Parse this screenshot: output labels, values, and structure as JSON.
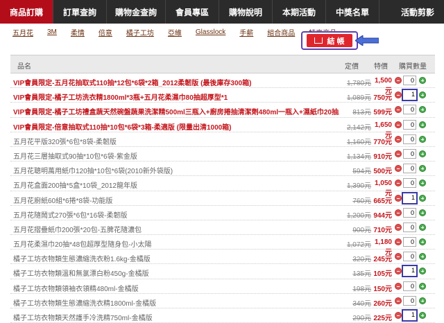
{
  "topnav": {
    "tabs": [
      {
        "label": "商品訂購",
        "active": true
      },
      {
        "label": "訂單查詢"
      },
      {
        "label": "購物金查詢"
      },
      {
        "label": "會員專區"
      },
      {
        "label": "購物說明"
      },
      {
        "label": "本期活動"
      },
      {
        "label": "中獎名單"
      },
      {
        "label": "活動剪影"
      }
    ]
  },
  "subnav": {
    "links": [
      "五月花",
      "3M",
      "柔情",
      "倍意",
      "橘子工坊",
      "亞維",
      "Glasslock",
      "手薪",
      "組合商品",
      "特賣商品"
    ]
  },
  "checkout": {
    "label": "結 帳"
  },
  "table": {
    "headers": {
      "name": "品名",
      "orig": "定價",
      "sale": "特價",
      "qty": "購買數量"
    },
    "rows": [
      {
        "name": "VIP會員限定-五月花抽取式110抽*12包*6袋*2箱_2012柔韌版 (最後庫存300箱)",
        "orig": "1,780元",
        "sale": "1,500元",
        "qty": "0",
        "vip": true
      },
      {
        "name": "VIP會員限定-橘子工坊洗衣精1800ml*3瓶+五月花柔濕巾80抽超厚型*1",
        "orig": "1,089元",
        "sale": "750元",
        "qty": "1",
        "vip": true,
        "highlight": true
      },
      {
        "name": "VIP會員限定-橘子工坊禮盒蔬天然碗盤蔬果洗潔精500ml三瓶入+廚房捲抽清潔劑480ml一瓶入+濕紙巾20抽三包",
        "orig": "813元",
        "sale": "599元",
        "qty": "0",
        "vip": true
      },
      {
        "name": "VIP會員限定-倍意抽取式110抽*10包*6袋*3箱-柔適版 (限量出清1000箱)",
        "orig": "2,142元",
        "sale": "1,650元",
        "qty": "0",
        "vip": true
      },
      {
        "name": "五月花平版320張*6包*8袋-柔韌版",
        "orig": "1,160元",
        "sale": "770元",
        "qty": "0"
      },
      {
        "name": "五月花三層抽取式90抽*10包*6袋-紫金版",
        "orig": "1,134元",
        "sale": "910元",
        "qty": "0"
      },
      {
        "name": "五月花聰明萬用紙巾120抽*10包*6袋(2010新外袋版)",
        "orig": "594元",
        "sale": "500元",
        "qty": "0"
      },
      {
        "name": "五月花盒面200抽*5盒*10袋_2012龍年版",
        "orig": "1,390元",
        "sale": "1,050元",
        "qty": "0"
      },
      {
        "name": "五月花廚紙60組*6捲*8袋-功能版",
        "orig": "760元",
        "sale": "665元",
        "qty": "1",
        "highlight": true
      },
      {
        "name": "五月花隨鬧式270張*6包*16袋-柔韌版",
        "orig": "1,200元",
        "sale": "944元",
        "qty": "0"
      },
      {
        "name": "五月花摺疊紙巾200張*20包-五脾花隨濃包",
        "orig": "900元",
        "sale": "710元",
        "qty": "0"
      },
      {
        "name": "五月花柔濕巾20抽*48包超厚型隨身包-小太陽",
        "orig": "1,072元",
        "sale": "1,180元",
        "qty": "0"
      },
      {
        "name": "橘子工坊衣物類生態濃縮洗衣粉1.6kg-金橘版",
        "orig": "320元",
        "sale": "245元",
        "qty": "0"
      },
      {
        "name": "橘子工坊衣物類溫和無氯漂白粉450g-金橘版",
        "orig": "135元",
        "sale": "105元",
        "qty": "1",
        "highlight": true
      },
      {
        "name": "橘子工坊衣物類領袖衣領精480ml-金橘版",
        "orig": "198元",
        "sale": "150元",
        "qty": "0"
      },
      {
        "name": "橘子工坊衣物類生態濃縮洗衣精1800ml-金橘版",
        "orig": "340元",
        "sale": "260元",
        "qty": "0"
      },
      {
        "name": "橘子工坊衣物類天然護手冷洗精750ml-金橘版",
        "orig": "290元",
        "sale": "225元",
        "qty": "1",
        "highlight": true
      }
    ]
  }
}
